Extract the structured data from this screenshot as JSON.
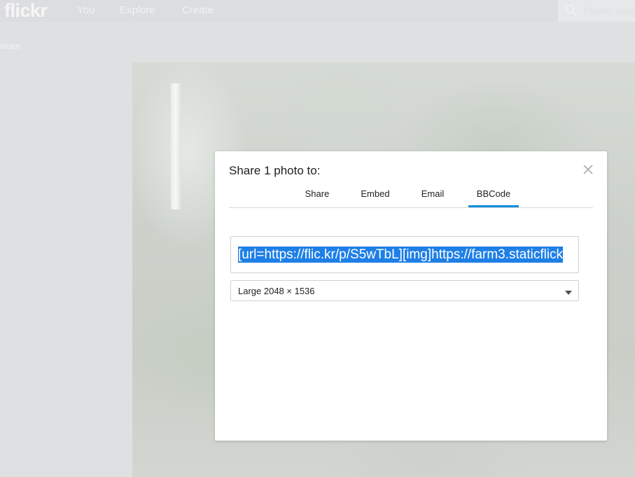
{
  "nav": {
    "logo": "flickr",
    "links": [
      "You",
      "Explore",
      "Create"
    ],
    "search_placeholder": "Photos, people"
  },
  "page": {
    "stream_label": "ream"
  },
  "modal": {
    "title": "Share 1 photo to:",
    "tabs": [
      "Share",
      "Embed",
      "Email",
      "BBCode"
    ],
    "active_tab": "BBCode",
    "code_value": "[url=https://flic.kr/p/S5wTbL][img]https://farm3.staticflick",
    "size_option": "Large 2048 × 1536"
  },
  "colors": {
    "accent": "#128fdc",
    "selection": "#1e7fe6"
  }
}
